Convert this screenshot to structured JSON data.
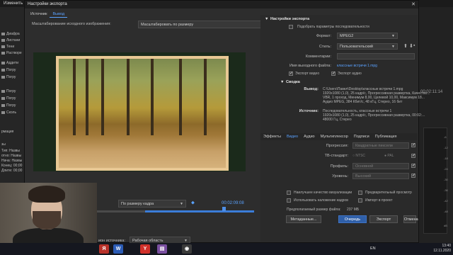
{
  "background": {
    "app_title": "Изменить",
    "left_panel_items": [
      "Диафра",
      "Листани",
      "Тени",
      "Растворе",
      "Аддити",
      "Погру",
      "Погру",
      "Погру",
      "Погру",
      "Погру",
      "Сколь"
    ],
    "info_lines": [
      "рмация",
      "зы",
      "Тип: Назвы",
      "отно: Назвы",
      "Нача: Назвы",
      "Конец: 00;00",
      "Длите: 00;00"
    ],
    "timecode": "00:02:11:14",
    "meter_ticks": [
      "-6",
      "-12",
      "-18",
      "-24",
      "-30",
      "-36",
      "-42",
      "-48",
      "dB"
    ]
  },
  "dialog": {
    "title": "Настройки экспорта",
    "tabs": [
      "Источник",
      "Вывод"
    ],
    "active_tab": "Вывод",
    "scale_label": "Масштабирование исходного изображения:",
    "scale_value": "Масштабировать по размеру",
    "fit_value": "По размеру кадра",
    "time": "00:02:09:08",
    "source_label": "ион источника:",
    "source_value": "Рабочая область"
  },
  "settings": {
    "header": "Настройки экспорта",
    "match_sequence": "Подобрать параметры последовательности",
    "format_label": "Формат:",
    "format_value": "MPEG2",
    "preset_label": "Стиль:",
    "preset_value": "Пользовательский",
    "comments_label": "Комментарии:",
    "output_label": "Имя выходного файла:",
    "output_value": "классные встречи 1.mpg",
    "export_video": "Экспорт видео",
    "export_audio": "Экспорт аудио",
    "summary_header": "Сводка",
    "output_title": "Вывод:",
    "output_text": [
      "C:\\Users\\Павел\\Desktop\\классные встречи 1.mpg",
      "1920x1080 (1,0), 25 кадр/с, Прогрессивная развертка, Качество...",
      "VBR, 1 проход, Минимум 8,00, Целевой 10,00, Максимум 18...",
      "Аудио MPEG, 384 Кбит/с, 48 кГц, Стерео, 16 бит"
    ],
    "source_title": "Источник:",
    "source_text": [
      "Последовательность, классные встречи 1",
      "1920x1080 (1,0), 25 кадр/с, Прогрессивная развертка, 00:02:...",
      "48000 Гц, Стерео"
    ],
    "tabs": [
      "Эффекты",
      "Видео",
      "Аудио",
      "Мультиплексор",
      "Подписи",
      "Публикация"
    ],
    "active_tab": "Видео",
    "quality_label": "Прогрессия:",
    "quality_value": "Квадратные пиксели",
    "tv_label": "ТВ-стандарт:",
    "tv_ntsc": "NTSC",
    "tv_pal": "PAL",
    "profile_label": "Профиль:",
    "profile_value": "Основной",
    "level_label": "Уровень:",
    "level_value": "Высокий",
    "render_max": "Наилучшее качество визуализации",
    "use_preview": "Предварительный просмотр",
    "use_frame_blend": "Использовать наложение кадров",
    "import_project": "Импорт в проект",
    "file_size_label": "Предполагаемый размер файла:",
    "file_size_value": "237 МБ",
    "metadata_btn": "Метаданные...",
    "queue_btn": "Очередь",
    "export_btn": "Экспорт",
    "cancel_btn": "Отмена"
  },
  "taskbar": {
    "lang": "EN",
    "time": "13:40",
    "date": "12.11.2020"
  }
}
